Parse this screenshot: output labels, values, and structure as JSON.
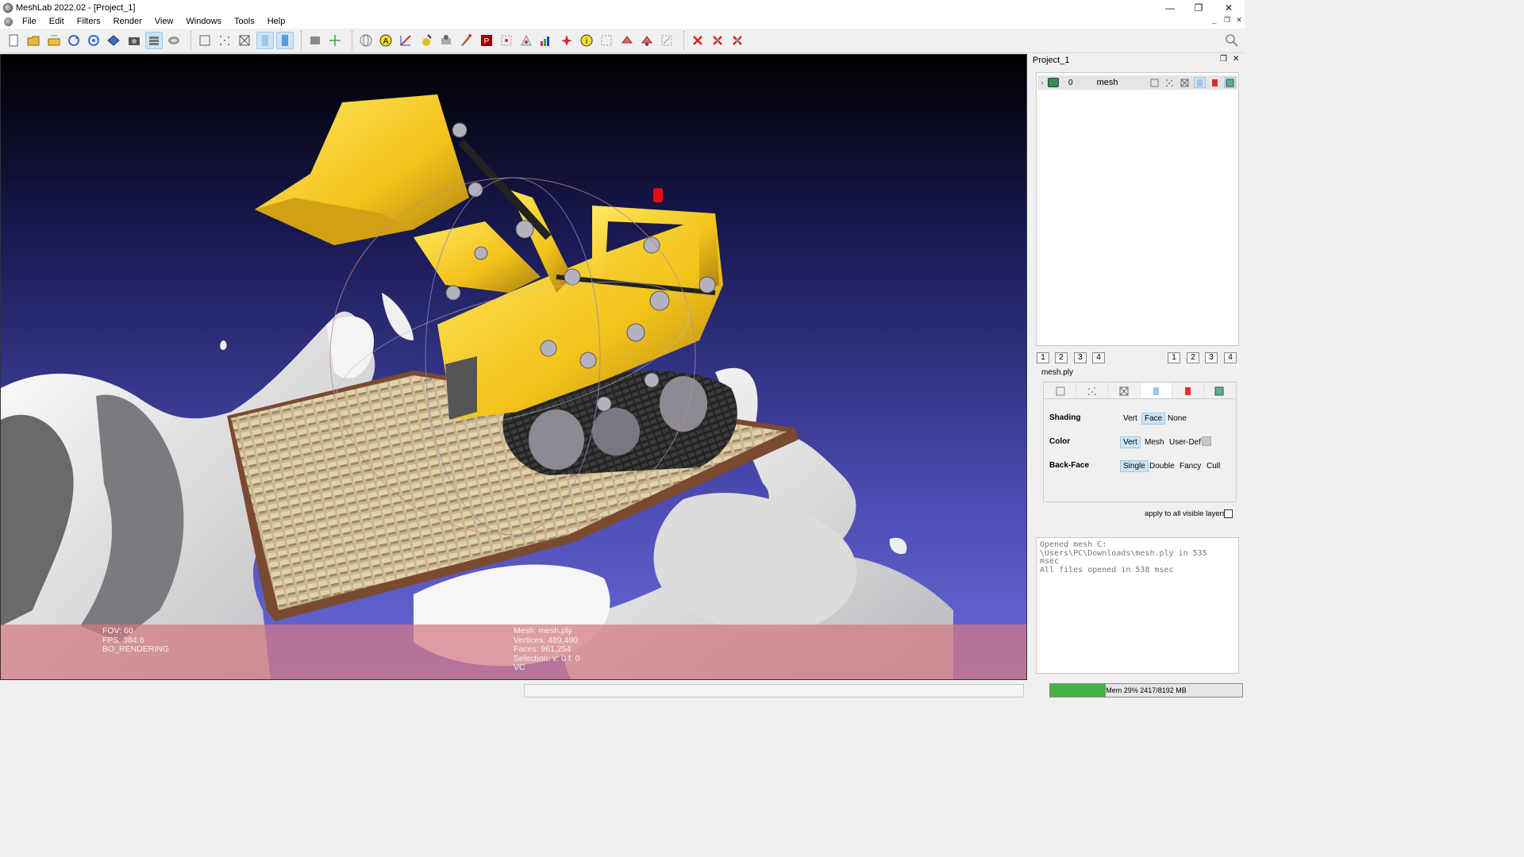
{
  "window": {
    "title": "MeshLab 2022.02 - [Project_1]",
    "min_glyph": "—",
    "max_glyph": "❐",
    "close_glyph": "✕"
  },
  "menu": {
    "items": [
      "File",
      "Edit",
      "Filters",
      "Render",
      "View",
      "Windows",
      "Tools",
      "Help"
    ]
  },
  "mdi": {
    "min": "_",
    "restore": "❐",
    "close": "✕"
  },
  "toolbar": {
    "buttons": [
      "new-project-icon",
      "open-project-icon",
      "import-mesh-icon",
      "reload-icon",
      "reload-all-icon",
      "export-mesh-icon",
      "snapshot-icon",
      "layers-icon",
      "stereo-icon",
      "sep",
      "bbox-icon",
      "points-icon",
      "wireframe-icon",
      "flat-icon",
      "smooth-icon",
      "sep",
      "texture-icon",
      "axes-icon",
      "sep",
      "trackball-icon",
      "annotation-icon",
      "measure-icon",
      "pick-points-icon",
      "align-icon",
      "paint-icon",
      "texture-param-icon",
      "select-vertices-icon",
      "select-faces-icon",
      "quality-icon",
      "z-paint-icon",
      "info-icon",
      "select-connected-icon",
      "select-faces-rect-icon",
      "select-vertices-rect-icon",
      "manipulator-icon",
      "sep",
      "delete-selected-icon",
      "delete-faces-icon",
      "delete-vertices-icon"
    ],
    "active": [
      "layers-icon",
      "flat-icon",
      "smooth-icon"
    ]
  },
  "viewport": {
    "info_left": [
      "FOV: 60",
      "FPS:   384.6",
      "BO_RENDERING"
    ],
    "info_right": [
      "Mesh: mesh.ply",
      "Vertices: 489,490",
      "Faces: 961,254",
      "Selection: v: 0 f: 0",
      "VC"
    ]
  },
  "layers_panel": {
    "title": "Project_1",
    "float_glyph": "❐",
    "close_glyph": "✕",
    "layers": [
      {
        "index": "0",
        "name": "mesh"
      }
    ],
    "numbers_left": [
      "1",
      "2",
      "3",
      "4"
    ],
    "numbers_right": [
      "1",
      "2",
      "3",
      "4"
    ],
    "mesh_file": "mesh.ply"
  },
  "render_options": {
    "shading": {
      "label": "Shading",
      "options": [
        "Vert",
        "Face",
        "None"
      ],
      "selected": "Face"
    },
    "color": {
      "label": "Color",
      "options": [
        "Vert",
        "Mesh",
        "User-Def"
      ],
      "selected": "Vert"
    },
    "backface": {
      "label": "Back-Face",
      "options": [
        "Single",
        "Double",
        "Fancy",
        "Cull"
      ],
      "selected": "Single"
    },
    "apply_all": "apply to all visible layers"
  },
  "log": {
    "text": "Opened mesh C:\n\\Users\\PC\\Downloads\\mesh.ply in 535\nmsec\nAll files opened in 538 msec"
  },
  "memory": {
    "label": "Mem 29% 2417/8192 MB",
    "fraction": 0.29
  },
  "colors": {
    "accent": "#cde4f7",
    "mem_fill": "#45b045",
    "bg_top": "#000000",
    "bg_bottom": "#6b6bd8"
  }
}
